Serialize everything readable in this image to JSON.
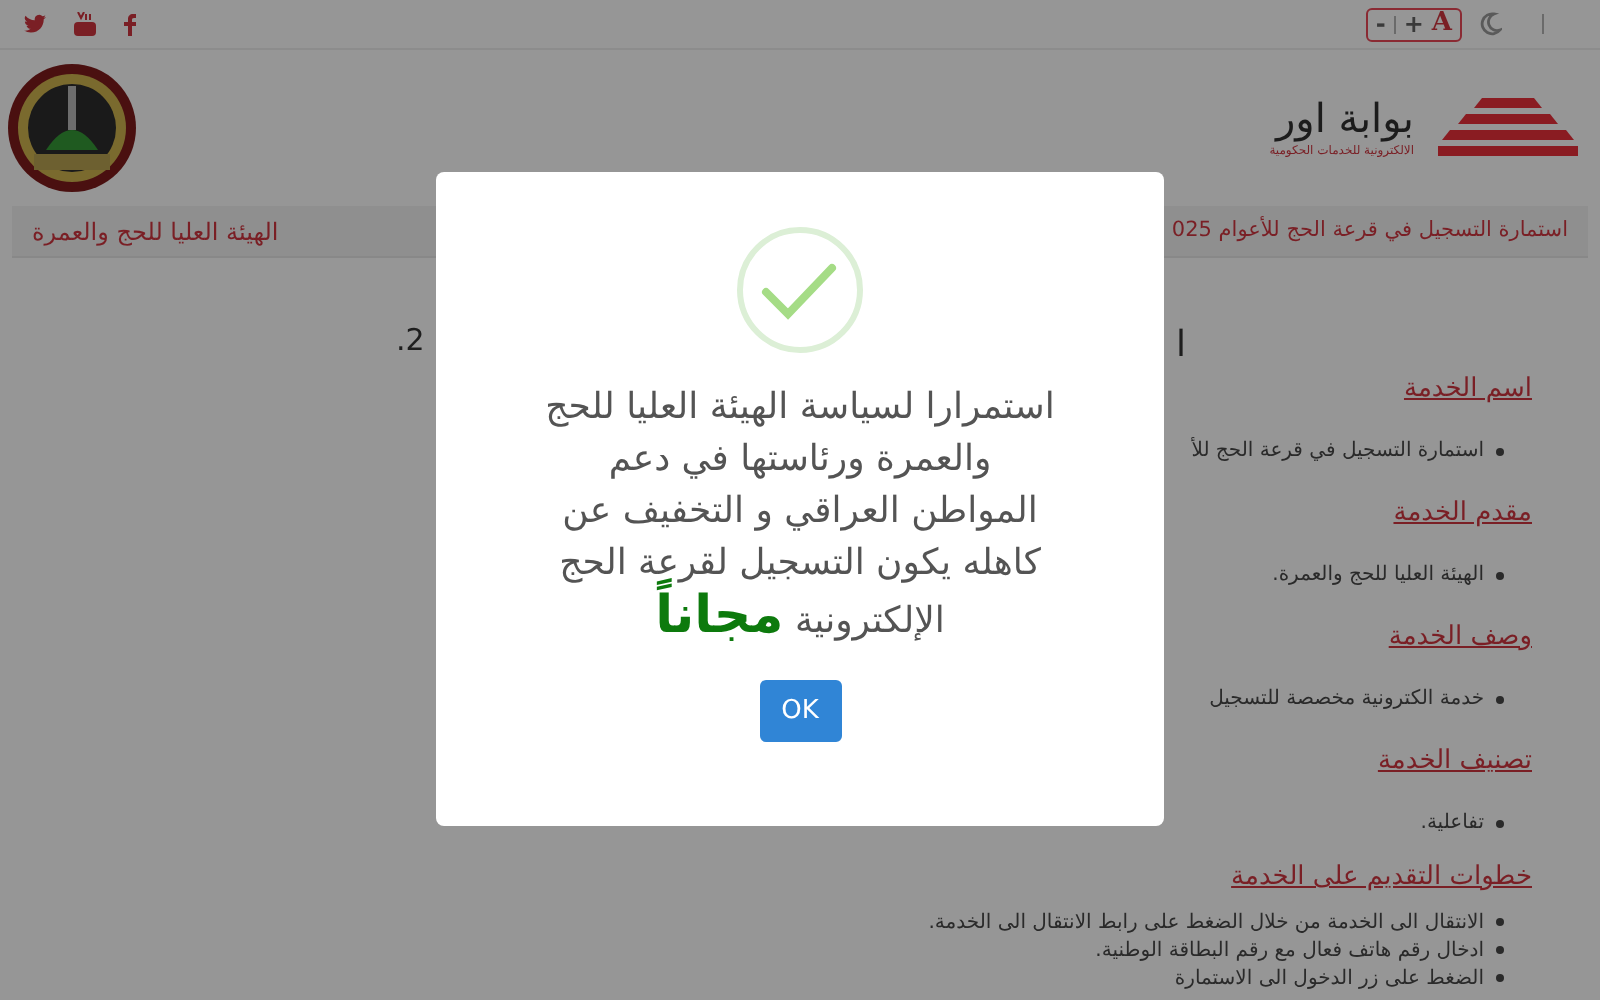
{
  "top_bar": {
    "social": [
      {
        "kind": "twitter"
      },
      {
        "kind": "youtube"
      },
      {
        "kind": "facebook"
      }
    ],
    "font_controls": [
      "A",
      "+",
      "-"
    ]
  },
  "header": {
    "logo_title": "بوابة اور",
    "logo_subtitle": "الالكترونية للخدمات الحكومية"
  },
  "nav": {
    "service_link": "استمارة التسجيل في قرعة الحج للأعوام 025",
    "authority_link": "الهيئة العليا للحج والعمرة"
  },
  "page_title_fragments": [
    "ا",
    ".2"
  ],
  "sections": [
    {
      "heading": "اسم الخدمة",
      "bullets": [
        "استمارة التسجيل في قرعة الحج للأ"
      ]
    },
    {
      "heading": "مقدم الخدمة",
      "bullets": [
        "الهيئة العليا للحج والعمرة."
      ]
    },
    {
      "heading": "وصف الخدمة",
      "bullets": [
        "خدمة الكترونية مخصصة للتسجيل"
      ]
    },
    {
      "heading": "تصنيف الخدمة",
      "bullets": [
        "تفاعلية."
      ]
    },
    {
      "heading": "خطوات التقديم على الخدمة",
      "bullets": [
        "الانتقال الى الخدمة من خلال الضغط على رابط الانتقال الى الخدمة.",
        "ادخال رقم هاتف فعال مع رقم البطاقة الوطنية.",
        "الضغط على زر الدخول الى الاستمارة"
      ]
    }
  ],
  "dialog": {
    "message_lines": [
      "استمرارا لسياسة الهيئة العليا للحج",
      "والعمرة ورئاستها في دعم",
      "المواطن العراقي و التخفيف عن",
      "كاهله يكون التسجيل لقرعة الحج",
      "الإلكترونية"
    ],
    "highlight": "مجاناً",
    "button": "OK"
  }
}
